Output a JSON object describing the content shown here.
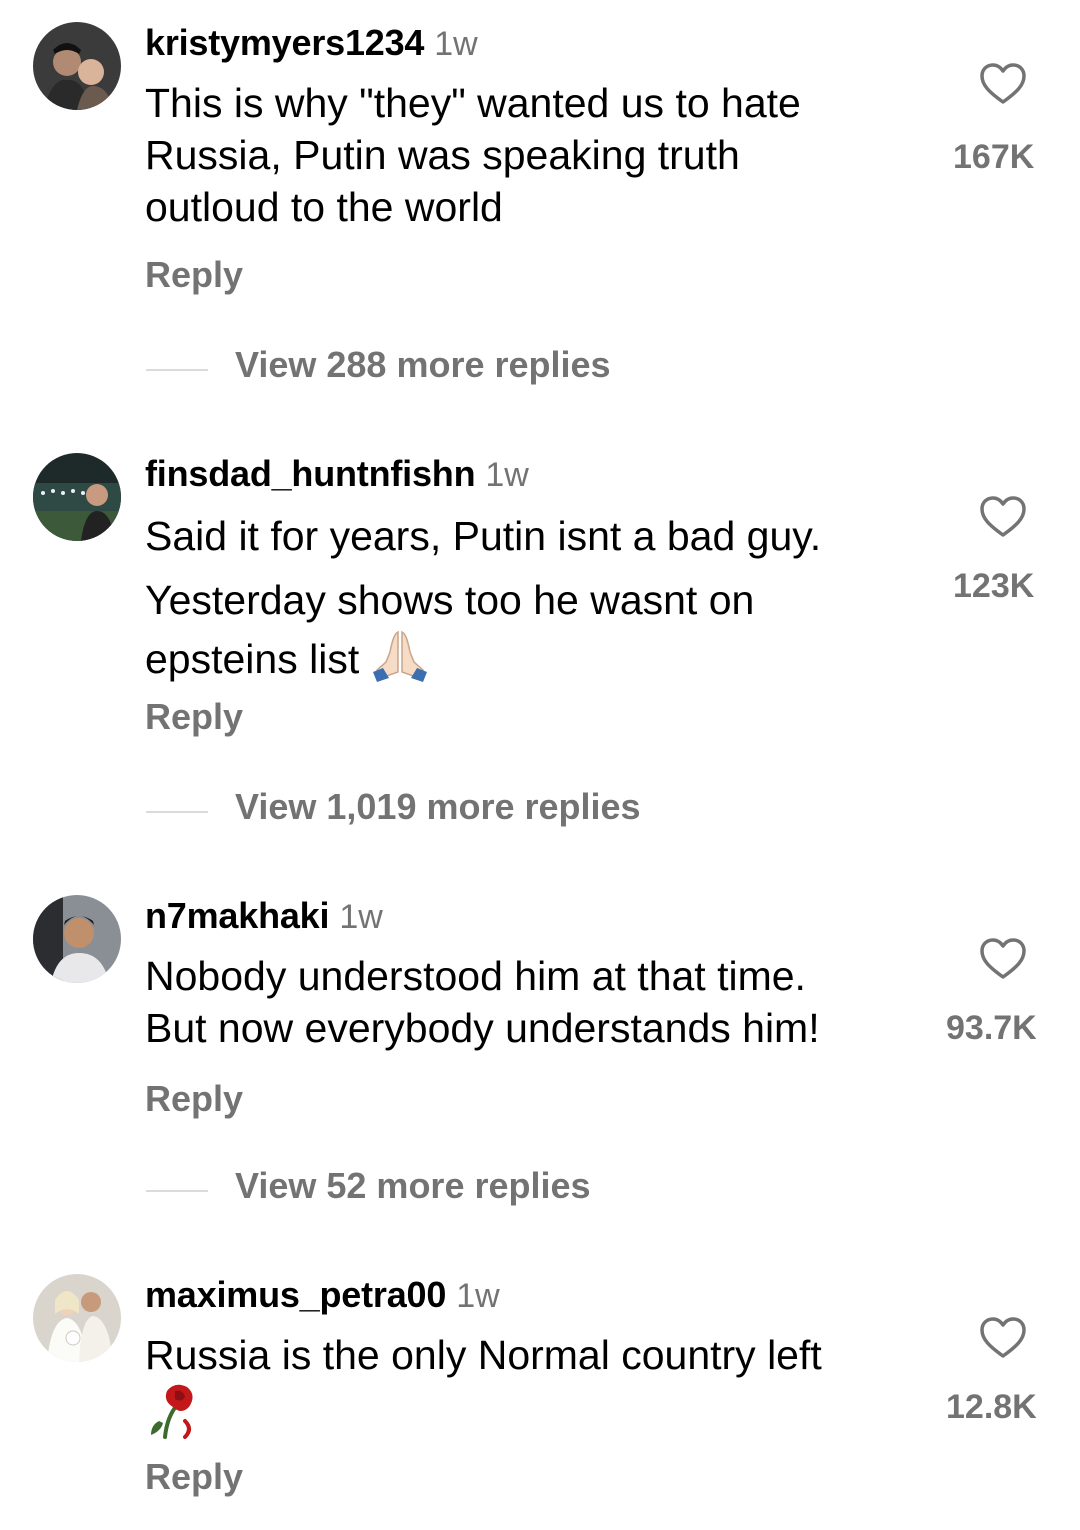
{
  "comments": [
    {
      "username": "kristymyers1234",
      "time": "1w",
      "lines": [
        "This is why \"they\" wanted us to hate",
        "Russia, Putin was speaking truth",
        "outloud to the world"
      ],
      "likes": "167K",
      "reply_label": "Reply",
      "view_replies": "View 288 more replies"
    },
    {
      "username": "finsdad_huntnfishn",
      "time": "1w",
      "lines": [
        "Said it for years, Putin isnt a bad guy.",
        "Yesterday shows too he wasnt on",
        "epsteins list"
      ],
      "emoji": "folded-hands-emoji",
      "likes": "123K",
      "reply_label": "Reply",
      "view_replies": "View 1,019 more replies"
    },
    {
      "username": "n7makhaki",
      "time": "1w",
      "lines": [
        "Nobody understood him at that time.",
        "But now everybody understands him!"
      ],
      "likes": "93.7K",
      "reply_label": "Reply",
      "view_replies": "View 52 more replies"
    },
    {
      "username": "maximus_petra00",
      "time": "1w",
      "lines": [
        "Russia is the only Normal country left"
      ],
      "emoji": "wilted-flower-emoji",
      "likes": "12.8K",
      "reply_label": "Reply"
    }
  ],
  "icons": {
    "like": "heart-outline-icon"
  },
  "colors": {
    "muted": "#737373",
    "divider": "#dbdbdb"
  }
}
